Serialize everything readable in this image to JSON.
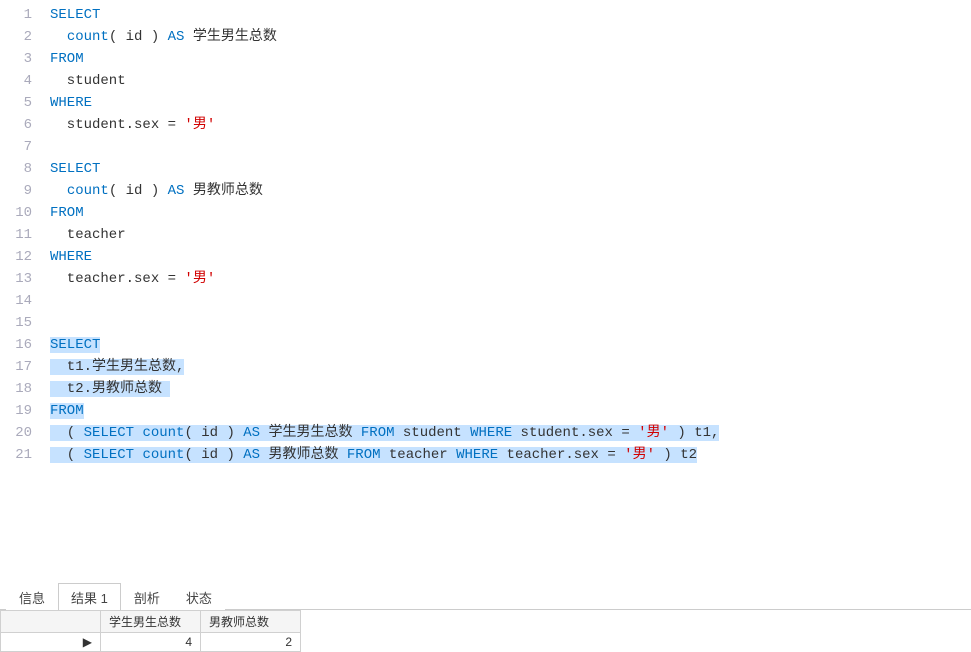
{
  "editor": {
    "lines": [
      {
        "n": 1,
        "sel": false,
        "tokens": [
          [
            "kw",
            "SELECT"
          ]
        ]
      },
      {
        "n": 2,
        "sel": false,
        "tokens": [
          [
            "plain",
            "  "
          ],
          [
            "kw",
            "count"
          ],
          [
            "plain",
            "( id ) "
          ],
          [
            "kw",
            "AS"
          ],
          [
            "plain",
            " 学生男生总数"
          ]
        ]
      },
      {
        "n": 3,
        "sel": false,
        "tokens": [
          [
            "kw",
            "FROM"
          ]
        ]
      },
      {
        "n": 4,
        "sel": false,
        "tokens": [
          [
            "plain",
            "  student"
          ]
        ]
      },
      {
        "n": 5,
        "sel": false,
        "tokens": [
          [
            "kw",
            "WHERE"
          ]
        ]
      },
      {
        "n": 6,
        "sel": false,
        "tokens": [
          [
            "plain",
            "  student.sex = "
          ],
          [
            "str",
            "'男'"
          ]
        ]
      },
      {
        "n": 7,
        "sel": false,
        "tokens": [
          [
            "plain",
            ""
          ]
        ]
      },
      {
        "n": 8,
        "sel": false,
        "tokens": [
          [
            "kw",
            "SELECT"
          ]
        ]
      },
      {
        "n": 9,
        "sel": false,
        "tokens": [
          [
            "plain",
            "  "
          ],
          [
            "kw",
            "count"
          ],
          [
            "plain",
            "( id ) "
          ],
          [
            "kw",
            "AS"
          ],
          [
            "plain",
            " 男教师总数"
          ]
        ]
      },
      {
        "n": 10,
        "sel": false,
        "tokens": [
          [
            "kw",
            "FROM"
          ]
        ]
      },
      {
        "n": 11,
        "sel": false,
        "tokens": [
          [
            "plain",
            "  teacher"
          ]
        ]
      },
      {
        "n": 12,
        "sel": false,
        "tokens": [
          [
            "kw",
            "WHERE"
          ]
        ]
      },
      {
        "n": 13,
        "sel": false,
        "tokens": [
          [
            "plain",
            "  teacher.sex = "
          ],
          [
            "str",
            "'男'"
          ]
        ]
      },
      {
        "n": 14,
        "sel": false,
        "tokens": [
          [
            "plain",
            ""
          ]
        ]
      },
      {
        "n": 15,
        "sel": false,
        "tokens": [
          [
            "plain",
            ""
          ]
        ]
      },
      {
        "n": 16,
        "sel": true,
        "tokens": [
          [
            "kw",
            "SELECT"
          ]
        ]
      },
      {
        "n": 17,
        "sel": true,
        "tokens": [
          [
            "plain",
            "  t1.学生男生总数,"
          ]
        ]
      },
      {
        "n": 18,
        "sel": true,
        "tokens": [
          [
            "plain",
            "  t2.男教师总数 "
          ]
        ]
      },
      {
        "n": 19,
        "sel": true,
        "tokens": [
          [
            "kw",
            "FROM"
          ]
        ]
      },
      {
        "n": 20,
        "sel": true,
        "tokens": [
          [
            "plain",
            "  ( "
          ],
          [
            "kw",
            "SELECT"
          ],
          [
            "plain",
            " "
          ],
          [
            "kw",
            "count"
          ],
          [
            "plain",
            "( id ) "
          ],
          [
            "kw",
            "AS"
          ],
          [
            "plain",
            " 学生男生总数 "
          ],
          [
            "kw",
            "FROM"
          ],
          [
            "plain",
            " student "
          ],
          [
            "kw",
            "WHERE"
          ],
          [
            "plain",
            " student.sex = "
          ],
          [
            "str",
            "'男'"
          ],
          [
            "plain",
            " ) t1,"
          ]
        ]
      },
      {
        "n": 21,
        "sel": true,
        "tokens": [
          [
            "plain",
            "  ( "
          ],
          [
            "kw",
            "SELECT"
          ],
          [
            "plain",
            " "
          ],
          [
            "kw",
            "count"
          ],
          [
            "plain",
            "( id ) "
          ],
          [
            "kw",
            "AS"
          ],
          [
            "plain",
            " 男教师总数 "
          ],
          [
            "kw",
            "FROM"
          ],
          [
            "plain",
            " teacher "
          ],
          [
            "kw",
            "WHERE"
          ],
          [
            "plain",
            " teacher.sex = "
          ],
          [
            "str",
            "'男'"
          ],
          [
            "plain",
            " ) t2"
          ]
        ]
      }
    ]
  },
  "tabs": {
    "items": [
      {
        "label": "信息",
        "active": false
      },
      {
        "label": "结果 1",
        "active": true
      },
      {
        "label": "剖析",
        "active": false
      },
      {
        "label": "状态",
        "active": false
      }
    ]
  },
  "results": {
    "columns": [
      "学生男生总数",
      "男教师总数"
    ],
    "rows": [
      {
        "cells": [
          "4",
          "2"
        ],
        "current": true
      }
    ]
  }
}
